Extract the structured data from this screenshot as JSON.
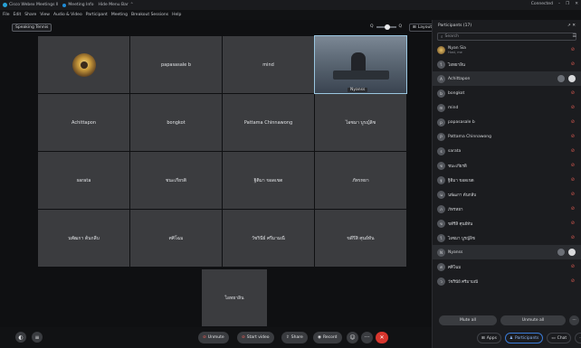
{
  "titlebar": {
    "app_title": "Cisco Webex Meetings ll",
    "meeting_info": "Meeting Info",
    "hide_menu_bar": "Hide Menu Bar",
    "connected": "Connected",
    "min": "–",
    "max": "❐",
    "close": "✕"
  },
  "menubar": [
    "File",
    "Edit",
    "Share",
    "View",
    "Audio & Video",
    "Participant",
    "Meeting",
    "Breakout Sessions",
    "Help"
  ],
  "stage": {
    "speaker_view_label": "Speaking Tennis",
    "zoom_min": "Q",
    "zoom_max": "Q",
    "layout_label": "Layout",
    "tiles": [
      {
        "label": "",
        "type": "avatar"
      },
      {
        "label": "papasasale b",
        "type": "name"
      },
      {
        "label": "mind",
        "type": "name"
      },
      {
        "label": "Nyanss",
        "type": "video"
      },
      {
        "label": "Achittapon",
        "type": "name"
      },
      {
        "label": "bongkot",
        "type": "name"
      },
      {
        "label": "Pattama Chinnawong",
        "type": "name"
      },
      {
        "label": "ไอซมา บูรญ์ลิช",
        "type": "name"
      },
      {
        "label": "sarata",
        "type": "name"
      },
      {
        "label": "ชนะเกียรติ",
        "type": "name"
      },
      {
        "label": "ฐิติมา ขอดเขต",
        "type": "name"
      },
      {
        "label": "ภัทรหยา",
        "type": "name"
      },
      {
        "label": "นพัฒกา ต้นกลีบ",
        "type": "name"
      },
      {
        "label": "ศศิโฉม",
        "type": "name"
      },
      {
        "label": "วัชรินีย์ ศรีมามณี",
        "type": "name"
      },
      {
        "label": "ขดีรีสิ ศุนย์ทัน",
        "type": "name"
      }
    ],
    "bottom_tile": "ไอทยาลิน"
  },
  "controls": {
    "unmute": "Unmute",
    "start_video": "Start video",
    "share": "Share",
    "record": "Record",
    "more": "···",
    "end": "✕"
  },
  "panel": {
    "title": "Participants (17)",
    "search_placeholder": "Search",
    "participants": [
      {
        "name": "Nyan Sia",
        "sub": "Host, me",
        "initial": "N"
      },
      {
        "name": "ไอทยาลิน",
        "sub": "",
        "initial": "ไ"
      },
      {
        "name": "Achittapon",
        "sub": "",
        "initial": "A"
      },
      {
        "name": "bongkot",
        "sub": "",
        "initial": "b"
      },
      {
        "name": "mind",
        "sub": "",
        "initial": "m"
      },
      {
        "name": "papasasale b",
        "sub": "",
        "initial": "p"
      },
      {
        "name": "Pattama Chinnawong",
        "sub": "",
        "initial": "P"
      },
      {
        "name": "sarata",
        "sub": "",
        "initial": "s"
      },
      {
        "name": "ชนะเกียรติ",
        "sub": "",
        "initial": "ช"
      },
      {
        "name": "ฐิติมา ขอดเขต",
        "sub": "",
        "initial": "ฐ"
      },
      {
        "name": "นพัฒกา ต้นกลีบ",
        "sub": "",
        "initial": "น"
      },
      {
        "name": "ภัทรหยา",
        "sub": "",
        "initial": "ภ"
      },
      {
        "name": "ขดีรีสิ ศุนย์ทัน",
        "sub": "",
        "initial": "ข"
      },
      {
        "name": "ไอซมา บูรญ์ลิช",
        "sub": "",
        "initial": "ไ"
      },
      {
        "name": "Nyanss",
        "sub": "",
        "initial": "N"
      },
      {
        "name": "ศศิโฉม",
        "sub": "",
        "initial": "ศ"
      },
      {
        "name": "วัชรินีย์ ศรีมามณี",
        "sub": "",
        "initial": "ว"
      }
    ],
    "mute_all": "Mute all",
    "unmute_all": "Unmute all",
    "more": "···"
  },
  "tray": {
    "apps": "Apps",
    "participants": "Participants",
    "chat": "Chat",
    "more": "···"
  }
}
